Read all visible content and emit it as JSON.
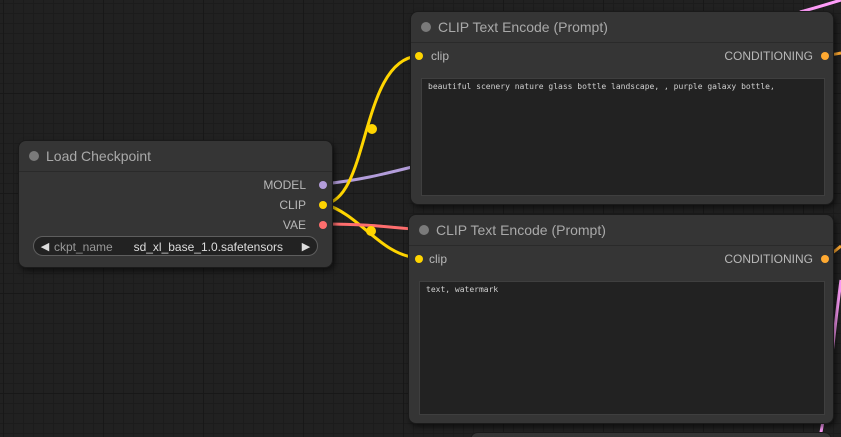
{
  "colors": {
    "model": "#b39ddb",
    "clip": "#ffd500",
    "vae": "#ff6e6e",
    "conditioning": "#ffa931",
    "latent": "#ff9cf9"
  },
  "load_checkpoint": {
    "title": "Load Checkpoint",
    "outputs": [
      "MODEL",
      "CLIP",
      "VAE"
    ],
    "widget": {
      "label": "ckpt_name",
      "value": "sd_xl_base_1.0.safetensors",
      "left_arrow": "◀",
      "right_arrow": "▶"
    }
  },
  "clip_encode_positive": {
    "title": "CLIP Text Encode (Prompt)",
    "input": "clip",
    "output": "CONDITIONING",
    "text": "beautiful scenery nature glass bottle landscape, , purple galaxy bottle,"
  },
  "clip_encode_negative": {
    "title": "CLIP Text Encode (Prompt)",
    "input": "clip",
    "output": "CONDITIONING",
    "text": "text, watermark"
  }
}
